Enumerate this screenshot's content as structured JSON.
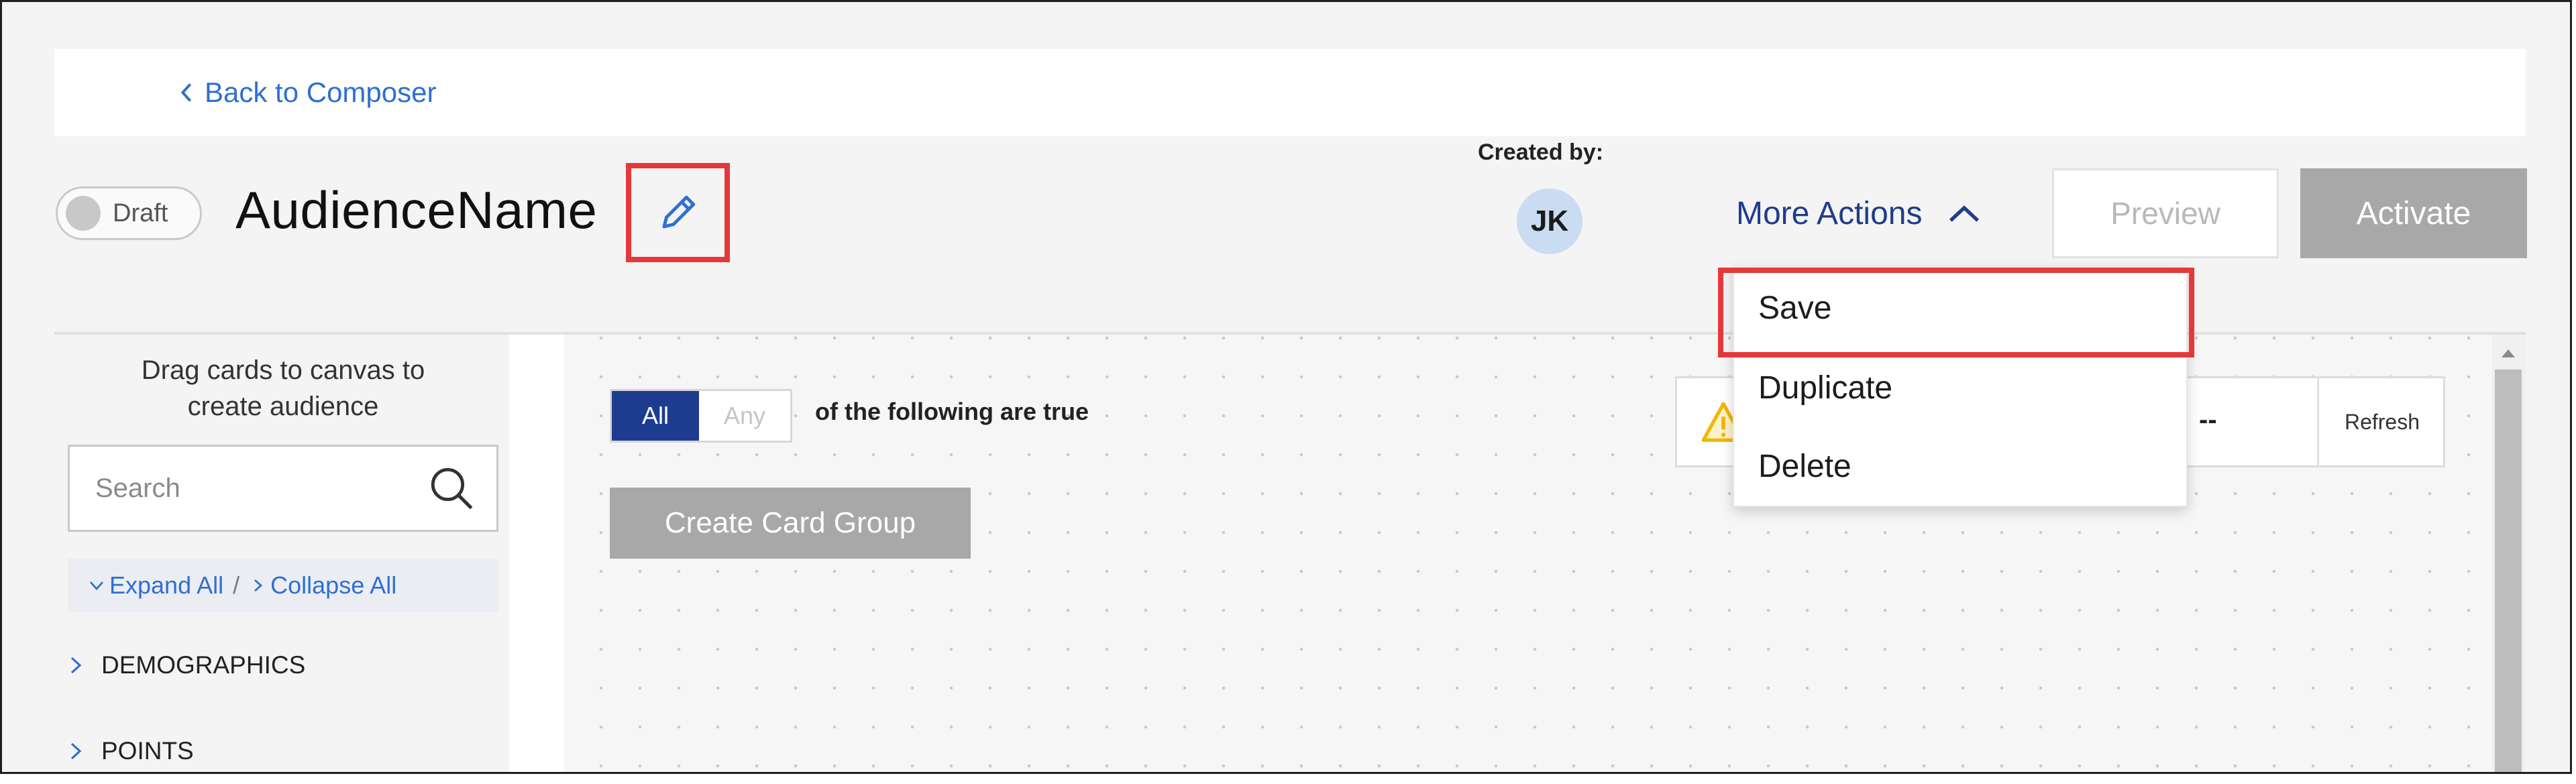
{
  "nav": {
    "back_label": "Back to Composer"
  },
  "audience": {
    "status_label": "Draft",
    "name": "AudienceName",
    "created_by_label": "Created by:",
    "creator_initials": "JK"
  },
  "actions": {
    "more_actions_label": "More Actions",
    "preview_label": "Preview",
    "activate_label": "Activate",
    "menu_items": [
      "Save",
      "Duplicate",
      "Delete"
    ]
  },
  "sidebar": {
    "help_line1": "Drag cards to canvas to",
    "help_line2": "create audience",
    "search_placeholder": "Search",
    "expand_all_label": "Expand All",
    "separator": "/",
    "collapse_all_label": "Collapse All",
    "categories": [
      "DEMOGRAPHICS",
      "POINTS"
    ]
  },
  "canvas": {
    "match_all_label": "All",
    "match_any_label": "Any",
    "match_mode": "All",
    "rule_text": "of the following are true",
    "create_group_label": "Create Card Group",
    "stats_value": "--",
    "refresh_label": "Refresh"
  },
  "colors": {
    "link": "#2f6fd1",
    "primary_navy": "#1e3c8f",
    "highlight": "#e5383b",
    "disabled_button": "#a8a8a8",
    "warning": "#f2b705"
  },
  "icons": {
    "back": "chevron-left-icon",
    "edit": "pencil-icon",
    "more_actions": "chevron-up-icon",
    "search": "search-icon",
    "warning": "warning-triangle-icon"
  }
}
